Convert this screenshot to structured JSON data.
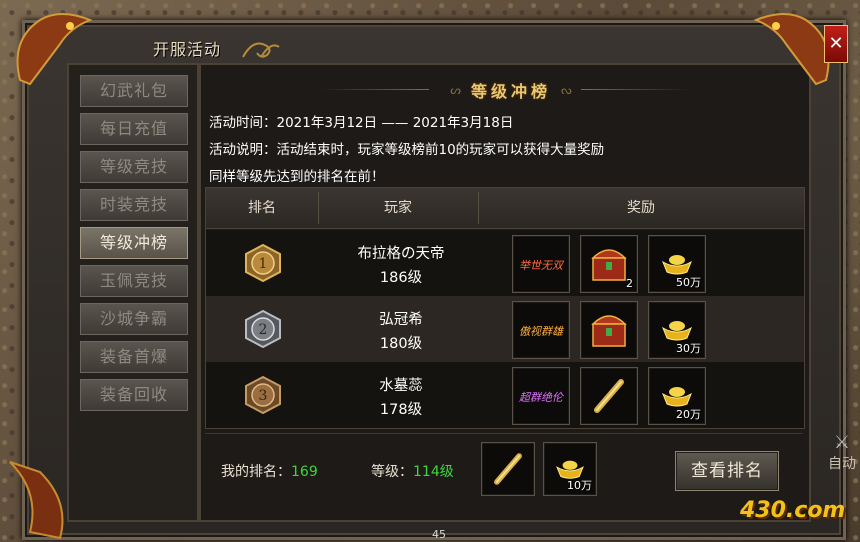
{
  "window": {
    "title": "开服活动"
  },
  "sidebar": {
    "items": [
      {
        "label": "幻武礼包"
      },
      {
        "label": "每日充值"
      },
      {
        "label": "等级竞技"
      },
      {
        "label": "时装竞技"
      },
      {
        "label": "等级冲榜",
        "active": true
      },
      {
        "label": "玉佩竞技"
      },
      {
        "label": "沙城争霸"
      },
      {
        "label": "装备首爆"
      },
      {
        "label": "装备回收"
      }
    ]
  },
  "content": {
    "banner_title": "等级冲榜",
    "time_line": "活动时间：2021年3月12日 —— 2021年3月18日",
    "desc_line1": "活动说明：活动结束时，玩家等级榜前10的玩家可以获得大量奖励",
    "desc_line2": "同样等级先达到的排名在前！",
    "table": {
      "headers": [
        "排名",
        "玩家",
        "奖励"
      ],
      "rows": [
        {
          "rank": "1",
          "name": "布拉格の天帝",
          "level": "186级",
          "rewards": [
            {
              "icon": "title-badge-icon",
              "text": "举世无双",
              "qty": ""
            },
            {
              "icon": "treasure-chest-icon",
              "qty": "2"
            },
            {
              "icon": "gold-ingot-icon",
              "qty": "50万"
            }
          ]
        },
        {
          "rank": "2",
          "name": "弘冠希",
          "level": "180级",
          "rewards": [
            {
              "icon": "title-badge-icon",
              "text": "傲视群雄",
              "qty": ""
            },
            {
              "icon": "treasure-chest-icon",
              "qty": ""
            },
            {
              "icon": "gold-ingot-icon",
              "qty": "30万"
            }
          ]
        },
        {
          "rank": "3",
          "name": "水墓蕊",
          "level": "178级",
          "rewards": [
            {
              "icon": "title-badge-icon",
              "text": "超群绝伦",
              "qty": ""
            },
            {
              "icon": "scroll-icon",
              "qty": ""
            },
            {
              "icon": "gold-ingot-icon",
              "qty": "20万"
            }
          ]
        }
      ]
    },
    "my": {
      "rank_label": "我的排名：",
      "rank_value": "169",
      "level_label": "等级：",
      "level_value": "114级",
      "rewards": [
        {
          "icon": "scroll-icon",
          "qty": ""
        },
        {
          "icon": "gold-ingot-icon",
          "qty": "10万"
        }
      ],
      "view_button": "查看排名"
    }
  },
  "hud": {
    "auto_label": "自动",
    "number": "45",
    "watermark": "430.com"
  },
  "colors": {
    "accent_gold": "#e9c873",
    "highlight_green": "#3ed63e",
    "close_red": "#c12018"
  }
}
